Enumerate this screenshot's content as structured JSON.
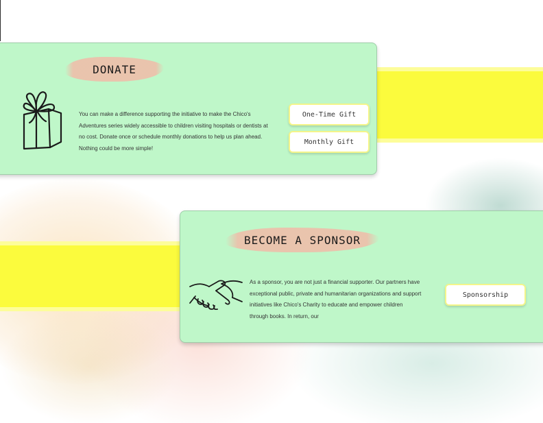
{
  "donate": {
    "title": "DONATE",
    "body": "You can make a difference supporting the initiative to make the Chico's Adventures series widely accessible to children visiting hospitals or dentists at no cost. Donate once or schedule monthly donations to help us plan ahead. Nothing could be more simple!",
    "icon": "gift-icon",
    "buttons": {
      "one_time": "One-Time Gift",
      "monthly": "Monthly Gift"
    }
  },
  "sponsor": {
    "title": "BECOME A SPONSOR",
    "body": "As a sponsor, you are not just a financial supporter. Our partners have exceptional public, private and humanitarian organizations and support initiatives like Chico's Charity to educate and empower children through books. In return, our",
    "icon": "handshake-icon",
    "button": "Sponsorship"
  },
  "colors": {
    "card_bg": "#bff7c9",
    "stripe": "#fbfb3d",
    "brush": "#eebeaa",
    "button_border": "#f4f58a"
  }
}
